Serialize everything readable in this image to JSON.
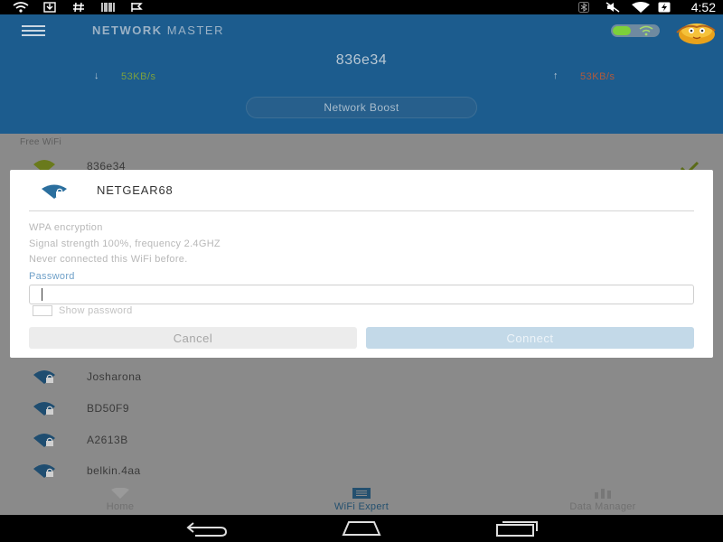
{
  "status_bar": {
    "time": "4:52",
    "icons": [
      "wifi-icon",
      "download-icon",
      "hash-icon",
      "barcode-icon",
      "flag-icon",
      "bluetooth-icon",
      "mute-icon",
      "wifi-signal-icon",
      "battery-charging-icon"
    ]
  },
  "header": {
    "app_title_bold": "NETWORK",
    "app_title_thin": "MASTER",
    "network_name": "836e34",
    "download_speed": "53KB/s",
    "upload_speed": "53KB/s",
    "boost_label": "Network Boost",
    "colors": {
      "background": "#1c5c8e",
      "download": "#7da13e",
      "upload": "#b05a3c"
    }
  },
  "list": {
    "section_label": "Free WiFi",
    "connected_network": "836e34",
    "networks": [
      {
        "name": "Josharona"
      },
      {
        "name": "BD50F9"
      },
      {
        "name": "A2613B"
      },
      {
        "name": "belkin.4aa"
      }
    ]
  },
  "dialog": {
    "title": "NETGEAR68",
    "encryption": "WPA encryption",
    "signal": "Signal strength 100%, frequency 2.4GHZ",
    "history": "Never connected this WiFi before.",
    "password_label": "Password",
    "password_value": "",
    "show_password_label": "Show password",
    "cancel_label": "Cancel",
    "connect_label": "Connect"
  },
  "tabs": [
    {
      "label": "Home",
      "icon": "wifi-icon"
    },
    {
      "label": "WiFi Expert",
      "icon": "list-icon"
    },
    {
      "label": "Data Manager",
      "icon": "bar-chart-icon"
    }
  ],
  "nav": {
    "icons": [
      "back-icon",
      "home-icon",
      "recents-icon"
    ]
  }
}
